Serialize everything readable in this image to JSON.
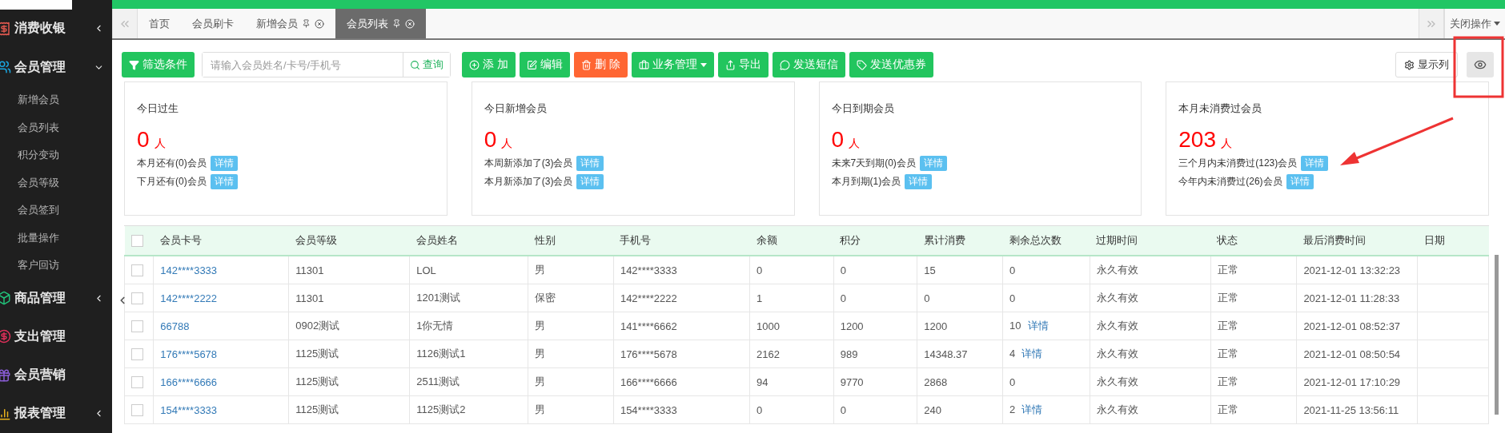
{
  "sidebar": {
    "items": [
      {
        "label": "消费收银",
        "color": "#e0584f",
        "expanded": false
      },
      {
        "label": "会员管理",
        "color": "#1aa6e0",
        "expanded": true,
        "children": [
          {
            "label": "新增会员"
          },
          {
            "label": "会员列表"
          },
          {
            "label": "积分变动"
          },
          {
            "label": "会员等级"
          },
          {
            "label": "会员签到"
          },
          {
            "label": "批量操作"
          },
          {
            "label": "客户回访"
          }
        ]
      },
      {
        "label": "商品管理",
        "color": "#22c27a",
        "expanded": false
      },
      {
        "label": "支出管理",
        "color": "#e0305a"
      },
      {
        "label": "会员营销",
        "color": "#8a5cd6"
      },
      {
        "label": "报表管理",
        "color": "#e8b21d",
        "expanded": false
      }
    ]
  },
  "tabs": [
    {
      "label": "首页",
      "selected": false,
      "closable": false
    },
    {
      "label": "会员刷卡",
      "selected": false,
      "closable": false
    },
    {
      "label": "新增会员",
      "selected": false,
      "closable": true
    },
    {
      "label": "会员列表",
      "selected": true,
      "closable": true
    }
  ],
  "tab_actions": {
    "close_menu": "关闭操作"
  },
  "toolbar": {
    "filter": "筛选条件",
    "search": {
      "placeholder": "请输入会员姓名/卡号/手机号",
      "button": "查询"
    },
    "buttons": [
      {
        "label": "添 加",
        "color": "#22c55e",
        "dropdown": false
      },
      {
        "label": "编辑",
        "color": "#22c55e",
        "dropdown": false
      },
      {
        "label": "删 除",
        "color": "#ff6633",
        "dropdown": false
      },
      {
        "label": "业务管理",
        "color": "#22c55e",
        "dropdown": true
      },
      {
        "label": "导出",
        "color": "#22c55e",
        "dropdown": false
      },
      {
        "label": "发送短信",
        "color": "#22c55e",
        "dropdown": false
      },
      {
        "label": "发送优惠券",
        "color": "#22c55e",
        "dropdown": false
      }
    ],
    "columns_button": "显示列"
  },
  "cards": [
    {
      "title": "今日过生",
      "count": "0",
      "unit": "人",
      "lines": [
        {
          "text": "本月还有(0)会员",
          "link": "详情"
        },
        {
          "text": "下月还有(0)会员",
          "link": "详情"
        }
      ]
    },
    {
      "title": "今日新增会员",
      "count": "0",
      "unit": "人",
      "lines": [
        {
          "text": "本周新添加了(3)会员",
          "link": "详情"
        },
        {
          "text": "本月新添加了(3)会员",
          "link": "详情"
        }
      ]
    },
    {
      "title": "今日到期会员",
      "count": "0",
      "unit": "人",
      "lines": [
        {
          "text": "未来7天到期(0)会员",
          "link": "详情"
        },
        {
          "text": "本月到期(1)会员",
          "link": "详情"
        }
      ]
    },
    {
      "title": "本月未消费过会员",
      "count": "203",
      "unit": "人",
      "lines": [
        {
          "text": "三个月内未消费过(123)会员",
          "link": "详情"
        },
        {
          "text": "今年内未消费过(26)会员",
          "link": "详情"
        }
      ]
    }
  ],
  "table": {
    "all_checked": false,
    "columns": [
      "会员卡号",
      "会员等级",
      "会员姓名",
      "性别",
      "手机号",
      "余额",
      "积分",
      "累计消费",
      "剩余总次数",
      "过期时间",
      "状态",
      "最后消费时间",
      "日期"
    ],
    "rows": [
      {
        "checked": false,
        "cells": [
          "142****3333",
          "11301",
          "LOL",
          "男",
          "142****3333",
          "0",
          "0",
          "15",
          "0",
          "永久有效",
          "正常",
          "2021-12-01 13:32:23"
        ]
      },
      {
        "checked": false,
        "cells": [
          "142****2222",
          "11301",
          "1201测试",
          "保密",
          "142****2222",
          "1",
          "0",
          "0",
          "0",
          "永久有效",
          "正常",
          "2021-12-01 11:28:33"
        ]
      },
      {
        "checked": false,
        "cells": [
          "66788",
          "0902测试",
          "1你无情",
          "男",
          "141****6662",
          "1000",
          "1200",
          "1200",
          "10",
          "永久有效",
          "正常",
          "2021-12-01 08:52:37"
        ],
        "detail": "详情"
      },
      {
        "checked": false,
        "cells": [
          "176****5678",
          "1125测试",
          "1126测试1",
          "男",
          "176****5678",
          "2162",
          "989",
          "14348.37",
          "4",
          "永久有效",
          "正常",
          "2021-12-01 08:50:54"
        ],
        "detail": "详情"
      },
      {
        "checked": false,
        "cells": [
          "166****6666",
          "1125测试",
          "2511测试",
          "男",
          "166****6666",
          "94",
          "9770",
          "2868",
          "0",
          "永久有效",
          "正常",
          "2021-12-01 17:10:29"
        ]
      },
      {
        "checked": false,
        "cells": [
          "154****3333",
          "1125测试",
          "1125测试2",
          "男",
          "154****3333",
          "0",
          "0",
          "240",
          "2",
          "永久有效",
          "正常",
          "2021-11-25 13:56:11"
        ],
        "detail": "详情"
      }
    ]
  }
}
